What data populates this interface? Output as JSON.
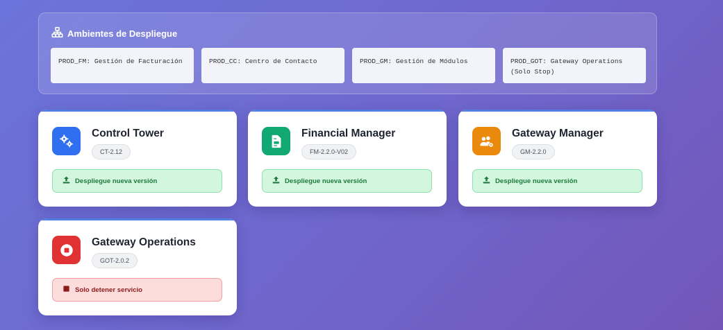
{
  "environments": {
    "title": "Ambientes de Despliegue",
    "icon": "sitemap-icon",
    "items": [
      {
        "code": "PROD_FM",
        "desc": ": Gestión de Facturación"
      },
      {
        "code": "PROD_CC",
        "desc": ": Centro de Contacto"
      },
      {
        "code": "PROD_GM",
        "desc": ": Gestión de Módulos"
      },
      {
        "code": "PROD_GOT",
        "desc": ": Gateway Operations (Solo Stop)"
      }
    ]
  },
  "apps": [
    {
      "name": "Control Tower",
      "version": "CT-2.12",
      "icon": "gears-icon",
      "color": "#2f6ff0",
      "action": "Despliegue nueva versión",
      "action_icon": "upload-icon"
    },
    {
      "name": "Financial Manager",
      "version": "FM-2.2.0-V02",
      "icon": "file-invoice-icon",
      "color": "#12a873",
      "action": "Despliegue nueva versión",
      "action_icon": "upload-icon"
    },
    {
      "name": "Gateway Manager",
      "version": "GM-2.2.0",
      "icon": "users-cog-icon",
      "color": "#ea8a0c",
      "action": "Despliegue nueva versión",
      "action_icon": "upload-icon"
    },
    {
      "name": "Gateway Operations",
      "version": "GOT-2.0.2",
      "icon": "stop-circle-icon",
      "color": "#e03232",
      "action": "Solo detener servicio",
      "action_icon": "stop-icon"
    }
  ]
}
